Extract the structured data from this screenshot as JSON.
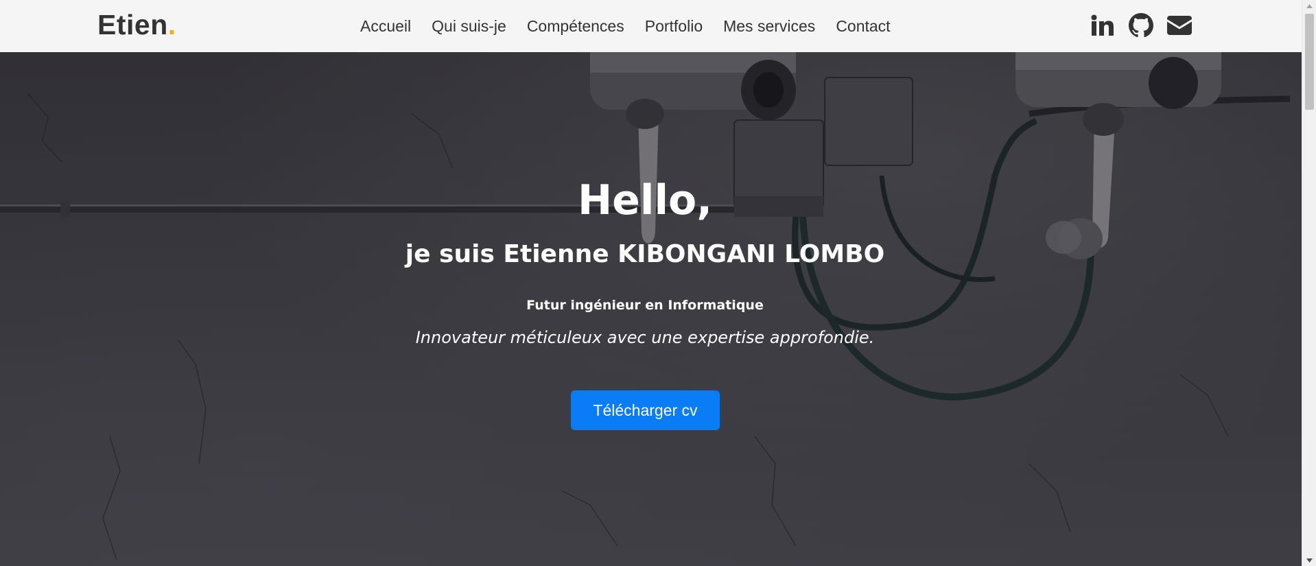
{
  "header": {
    "brand": "Etien",
    "brand_dot": ".",
    "nav": [
      {
        "label": "Accueil"
      },
      {
        "label": "Qui suis-je"
      },
      {
        "label": "Compétences"
      },
      {
        "label": "Portfolio"
      },
      {
        "label": "Mes services"
      },
      {
        "label": "Contact"
      }
    ],
    "social": [
      {
        "icon": "linkedin-icon"
      },
      {
        "icon": "github-icon"
      },
      {
        "icon": "envelope-icon"
      }
    ]
  },
  "hero": {
    "title": "Hello,",
    "name": "je suis Etienne KIBONGANI LOMBO",
    "role": "Futur ingénieur en Informatique",
    "tagline": "Innovateur méticuleux avec une expertise approfondie.",
    "cv_button": "Télécharger cv"
  },
  "colors": {
    "brand_dot": "#f0ad1c",
    "button": "#0a7cf5",
    "navbar_bg": "#f5f5f5",
    "nav_text": "#333333"
  }
}
